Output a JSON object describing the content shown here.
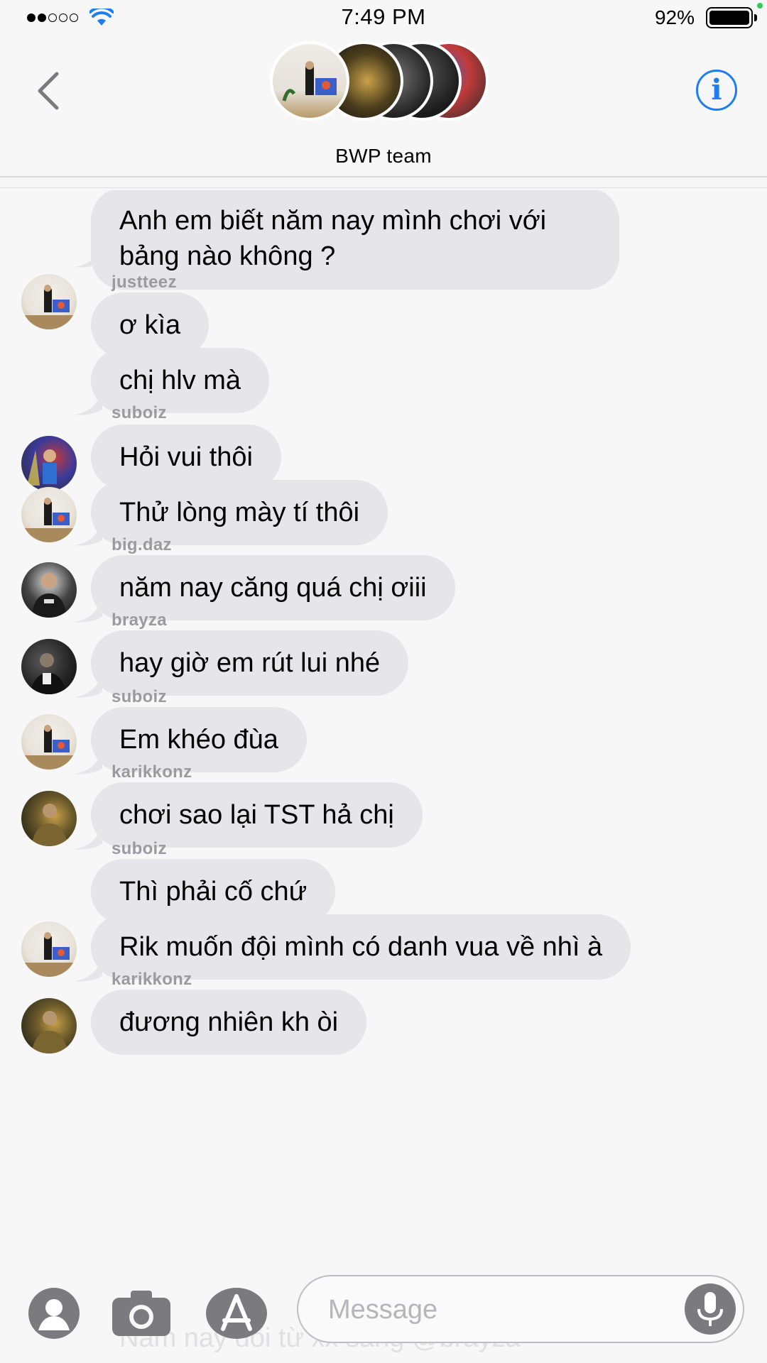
{
  "status_bar": {
    "time": "7:49 PM",
    "battery_percent": "92%",
    "signal_bars_filled": 2,
    "signal_bars_total": 5
  },
  "header": {
    "group_name": "BWP team",
    "back_icon": "chevron-left-icon",
    "info_icon": "info-icon",
    "info_glyph": "i",
    "accent_color": "#1f7cf2"
  },
  "messages": [
    {
      "sender": "suboiz",
      "text": "Anh em biết năm nay mình chơi với bảng nào không ?",
      "avatar": "suboiz"
    },
    {
      "sender": "justteez",
      "text": "ơ kìa"
    },
    {
      "text": "chị hlv mà",
      "avatar": "justteez"
    },
    {
      "sender": "suboiz",
      "text": "Hỏi vui thôi"
    },
    {
      "text": "Thử lòng mày tí thôi",
      "avatar": "suboiz"
    },
    {
      "sender": "big.daz",
      "text": "năm nay căng quá chị ơiii",
      "avatar": "big.daz"
    },
    {
      "sender": "brayza",
      "text": "hay giờ em rút lui nhé",
      "avatar": "brayza"
    },
    {
      "sender": "suboiz",
      "text": "Em khéo đùa",
      "avatar": "suboiz"
    },
    {
      "sender": "karikkonz",
      "text": "chơi sao lại TST hả chị",
      "avatar": "karikkonz"
    },
    {
      "sender": "suboiz",
      "text": "Thì phải cố chứ"
    },
    {
      "text": "Rik muốn đội mình có danh vua về nhì à",
      "avatar": "suboiz"
    },
    {
      "sender": "karikkonz",
      "text": "đương nhiên kh òi",
      "avatar": "karikkonz"
    }
  ],
  "input_bar": {
    "placeholder": "Message",
    "ghost_text": "Năm nay đổi từ xx sang @brayza",
    "icons": [
      "contact-icon",
      "camera-icon",
      "app-store-icon",
      "microphone-icon"
    ]
  },
  "colors": {
    "bubble_gray": "#e5e5ea",
    "sender_gray": "#9a9a9f",
    "background": "#f7f7f7"
  }
}
